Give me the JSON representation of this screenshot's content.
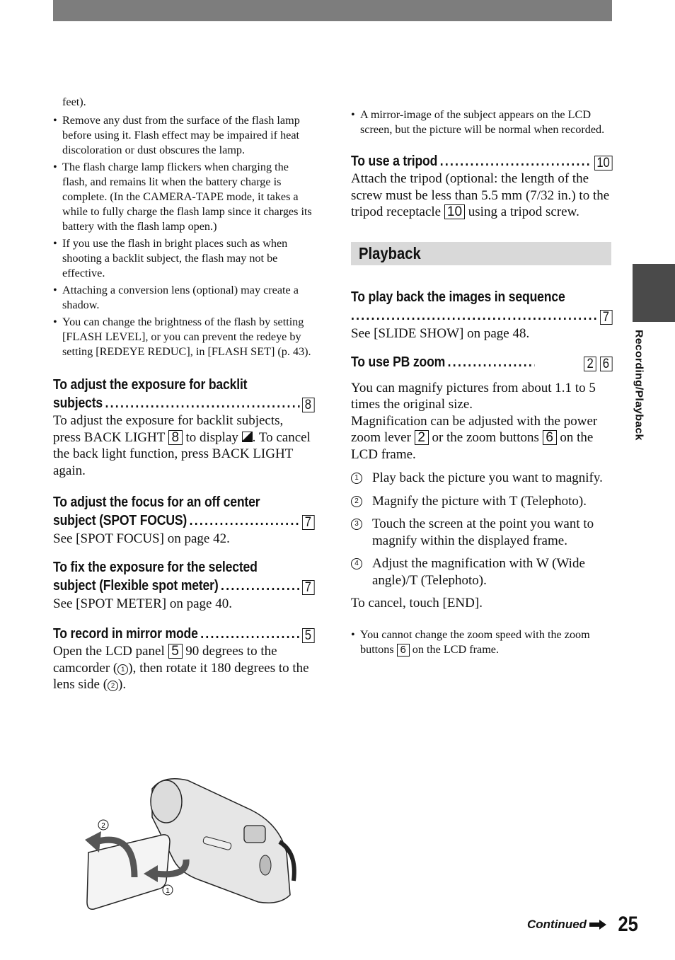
{
  "page": {
    "number": "25",
    "continued_label": "Continued",
    "side_tab_label": "Recording/Playback"
  },
  "left": {
    "carryover": "feet).",
    "bullets": [
      "Remove any dust from the surface of the flash lamp before using it. Flash effect may be impaired if heat discoloration or dust obscures the lamp.",
      "The flash charge lamp flickers when charging the flash, and remains lit when the battery charge is complete. (In the CAMERA-TAPE mode, it takes a while to fully charge the flash lamp since it charges its battery with the flash lamp open.)",
      "If you use the flash in bright places such as when shooting a backlit subject, the flash may not be effective.",
      "Attaching a conversion lens (optional) may create a shadow.",
      "You can change the brightness of the flash by setting [FLASH LEVEL], or you can prevent the redeye by setting [REDEYE REDUC], in [FLASH SET] (p. 43)."
    ],
    "backlight": {
      "title_line1": "To adjust the exposure for backlit",
      "title_line2": "subjects",
      "ref": "8",
      "body_a": "To adjust the exposure for backlit subjects, press BACK LIGHT",
      "body_ref": "8",
      "body_b": "to display",
      "body_icon": "backlight-icon",
      "body_c": ". To cancel the back light function, press BACK LIGHT again."
    },
    "spot_focus": {
      "title_line1": "To adjust the focus for an off center",
      "title_line2": "subject (SPOT FOCUS)",
      "ref": "7",
      "body": "See [SPOT FOCUS] on page 42."
    },
    "spot_meter": {
      "title_line1": "To fix the exposure for the selected",
      "title_line2": "subject (Flexible spot meter)",
      "ref": "7",
      "body": "See [SPOT METER] on page 40."
    },
    "mirror": {
      "title": "To record in mirror mode",
      "ref": "5",
      "body_a": "Open the LCD panel",
      "body_ref": "5",
      "body_b": "90 degrees to the camcorder (",
      "step1": "1",
      "body_c": "), then rotate it 180 degrees to the lens side (",
      "step2": "2",
      "body_d": ")."
    },
    "figure": {
      "label1": "1",
      "label2": "2"
    }
  },
  "right": {
    "mirror_note": "A mirror-image of the subject appears on the LCD screen, but the picture will be normal when recorded.",
    "tripod": {
      "title": "To use a tripod",
      "ref": "10",
      "body_a": "Attach the tripod (optional: the length of the screw must be less than 5.5 mm (7/32 in.) to the tripod receptacle",
      "body_ref": "10",
      "body_b": "using a tripod screw."
    },
    "section_title": "Playback",
    "sequence": {
      "title": "To play back the images in sequence",
      "ref": "7",
      "body": "See [SLIDE SHOW] on page 48."
    },
    "pb_zoom": {
      "title": "To use PB zoom",
      "ref1": "2",
      "ref2": "6",
      "intro1": "You can magnify pictures from about 1.1 to 5 times the original size.",
      "intro2_a": "Magnification can be adjusted with the power zoom lever",
      "intro2_ref1": "2",
      "intro2_b": "or the zoom buttons",
      "intro2_ref2": "6",
      "intro2_c": "on the LCD frame.",
      "steps": [
        {
          "num": "1",
          "text": "Play back the picture you want to magnify."
        },
        {
          "num": "2",
          "text": "Magnify the picture with T (Telephoto)."
        },
        {
          "num": "3",
          "text": "Touch the screen at the point you want to magnify within the displayed frame."
        },
        {
          "num": "4",
          "text": "Adjust the magnification with W (Wide angle)/T (Telephoto)."
        }
      ],
      "cancel": "To cancel, touch [END].",
      "note_a": "You cannot change the zoom speed with the zoom buttons",
      "note_ref": "6",
      "note_b": "on the LCD frame."
    }
  }
}
